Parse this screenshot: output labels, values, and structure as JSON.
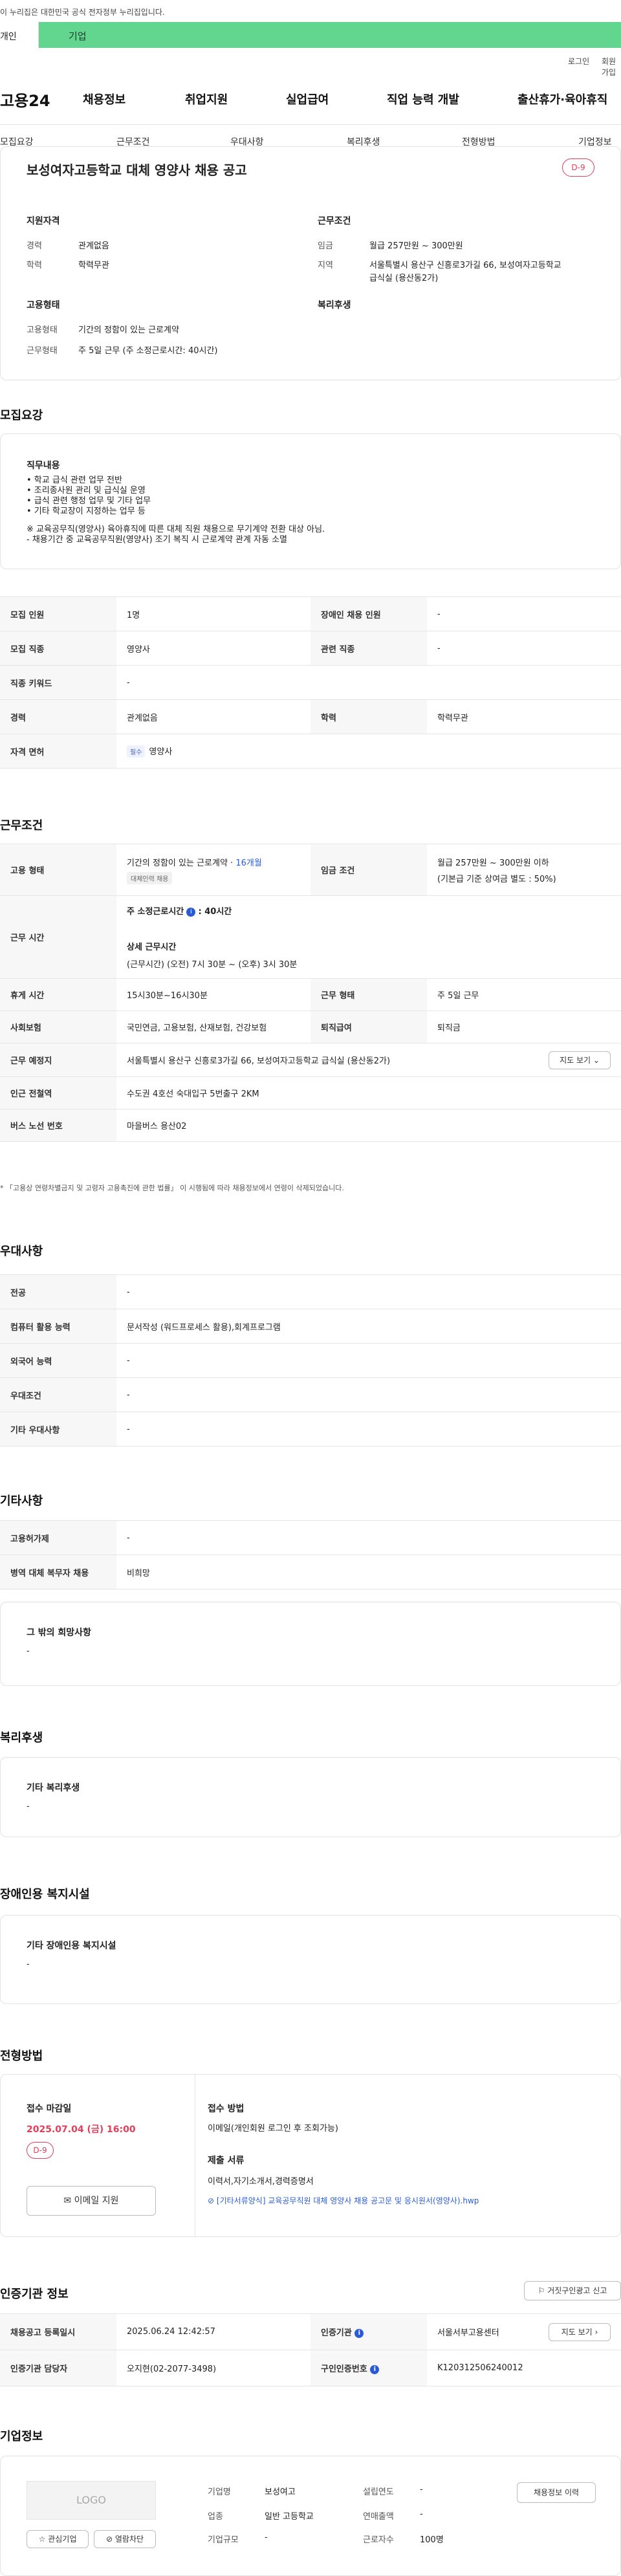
{
  "notice": "이 누리집은 대한민국 공식 전자정부 누리집입니다.",
  "usertabs": [
    "개인",
    "기업"
  ],
  "util": [
    "로그인",
    "회원가입"
  ],
  "gnb": {
    "logo": "고용24",
    "menu": [
      "채용정보",
      "취업지원",
      "실업급여",
      "직업 능력 개발",
      "출산휴가·육아휴직"
    ]
  },
  "subnav": [
    "모집요강",
    "근무조건",
    "우대사항",
    "복리후생",
    "전형방법",
    "기업정보"
  ],
  "summary": {
    "title": "보성여자고등학교 대체 영양사 채용 공고",
    "dday": "D-9",
    "qual_title": "지원자격",
    "qual": [
      {
        "k": "경력",
        "v": "관계없음"
      },
      {
        "k": "학력",
        "v": "학력무관"
      }
    ],
    "cond_title": "근무조건",
    "cond": [
      {
        "k": "임금",
        "v": "월급 257만원 ~ 300만원"
      },
      {
        "k": "지역",
        "v": "서울특별시 용산구 신흥로3가길 66, 보성여자고등학교"
      },
      {
        "k": "",
        "v": "급식실 (용산동2가)"
      }
    ],
    "emp_title": "고용형태",
    "emp": [
      {
        "k": "고용형태",
        "v": "기간의 정함이 있는 근로계약"
      },
      {
        "k": "근무형태",
        "v": "주 5일 근무 (주 소정근로시간: 40시간)"
      }
    ],
    "welfare_title": "복리후생"
  },
  "recruit": {
    "title": "모집요강",
    "duty_title": "직무내용",
    "duty_lines": [
      "• 학교 급식 관련 업무 전반",
      "• 조리종사원 관리 및 급식실 운영",
      "• 급식 관련 행정 업무 및 기타 업무",
      "• 기타 학교장이 지정하는 업무 등",
      "",
      "※ 교육공무직(영양사) 육아휴직에 따른 대체 직원 채용으로 무기계약 전환 대상 아님.",
      "- 채용기간 중 교육공무직원(영양사) 조기 복직 시 근로계약 관계 자동 소멸"
    ],
    "rows": [
      {
        "h1": "모집 인원",
        "v1": "1명",
        "h2": "장애인 채용 인원",
        "v2": "-"
      },
      {
        "h1": "모집 직종",
        "v1": "영양사",
        "h2": "관련 직종",
        "v2": "-"
      },
      {
        "h1": "직종 키워드",
        "v1": "-"
      },
      {
        "h1": "경력",
        "v1": "관계없음",
        "h2": "학력",
        "v2": "학력무관"
      },
      {
        "h1": "자격 면허",
        "tag": "필수",
        "v1": "영양사"
      }
    ]
  },
  "work": {
    "title": "근무조건",
    "emp_type_h": "고용 형태",
    "emp_type_v": "기간의 정함이 있는 근로계약 · ",
    "emp_type_months": "16개월",
    "emp_type_tag": "대체인력 채용",
    "wage_h": "임금 조건",
    "wage_v1": "월급 257만원 ~ 300만원 이하",
    "wage_v2": "(기본급 기준 상여금 별도 : 50%)",
    "time_h": "근무 시간",
    "time_week": "주 소정근로시간",
    "time_week_v": ": 40시간",
    "time_detail_title": "상세 근무시간",
    "time_detail": "(근무시간) (오전) 7시 30분 ~ (오후) 3시 30분",
    "rest_h": "휴게 시간",
    "rest_v": "15시30분~16시30분",
    "form_h": "근무 형태",
    "form_v": "주 5일 근무",
    "ins_h": "사회보험",
    "ins_v": "국민연금, 고용보험, 산재보험, 건강보험",
    "sev_h": "퇴직급여",
    "sev_v": "퇴직금",
    "place_h": "근무 예정지",
    "place_v": "서울특별시 용산구 신흥로3가길 66, 보성여자고등학교 급식실 (용산동2가)",
    "map_btn": "지도 보기",
    "subway_h": "인근 전철역",
    "subway_v": "수도권 4호선 숙대입구 5번출구 2KM",
    "bus_h": "버스 노선 번호",
    "bus_v": "마을버스 용산02",
    "footnote": "* 「고용상 연령차별금지 및 고령자 고용촉진에 관한 법률」 이 시행됨에 따라 채용정보에서 연령이 삭제되었습니다."
  },
  "pref": {
    "title": "우대사항",
    "rows": [
      {
        "h": "전공",
        "v": "-"
      },
      {
        "h": "컴퓨터 활용 능력",
        "v": "문서작성 (워드프로세스 활용),회계프로그램"
      },
      {
        "h": "외국어 능력",
        "v": "-"
      },
      {
        "h": "우대조건",
        "v": "-"
      },
      {
        "h": "기타 우대사항",
        "v": "-"
      }
    ]
  },
  "etc": {
    "title": "기타사항",
    "rows": [
      {
        "h": "고용허가제",
        "v": "-"
      },
      {
        "h": "병역 대체 복무자 채용",
        "v": "비희망"
      }
    ],
    "hope_title": "그 밖의 희망사항",
    "hope_v": "-"
  },
  "welfare": {
    "title": "복리후생",
    "box_title": "기타 복리후생",
    "box_v": "-"
  },
  "disab": {
    "title": "장애인용 복지시설",
    "box_title": "기타 장애인용 복지시설",
    "box_v": "-"
  },
  "process": {
    "title": "전형방법",
    "deadline_title": "접수 마감일",
    "deadline": "2025.07.04 (금) 16:00",
    "dday": "D-9",
    "email_btn": "이메일 지원",
    "method_title": "접수 방법",
    "method_v": "이메일(개인회원 로그인 후 조회가능)",
    "docs_title": "제출 서류",
    "docs_v": "이력서,자기소개서,경력증명서",
    "file": "[기타서류양식] 교육공무직원 대체 영양사 채용 공고문 및 응시원서(영양사).hwp"
  },
  "agency": {
    "title": "인증기관 정보",
    "report_btn": "거짓구인광고 신고",
    "reg_h": "채용공고 등록일시",
    "reg_v": "2025.06.24 12:42:57",
    "org_h": "인증기관",
    "org_v": "서울서부고용센터",
    "map_btn": "지도 보기",
    "mgr_h": "인증기관 담당자",
    "mgr_v": "오지현(02-2077-3498)",
    "num_h": "구인인증번호",
    "num_v": "K120312506240012"
  },
  "company": {
    "title": "기업정보",
    "logo": "LOGO",
    "fav_btn": "관심기업",
    "block_btn": "열람차단",
    "name_k": "기업명",
    "name_v": "보성여고",
    "est_k": "설립연도",
    "est_v": "-",
    "ind_k": "업종",
    "ind_v": "일반 고등학교",
    "sales_k": "연매출액",
    "sales_v": "-",
    "size_k": "기업규모",
    "size_v": "-",
    "emp_k": "근로자수",
    "emp_v": "100명",
    "history_btn": "채용정보 이력"
  }
}
